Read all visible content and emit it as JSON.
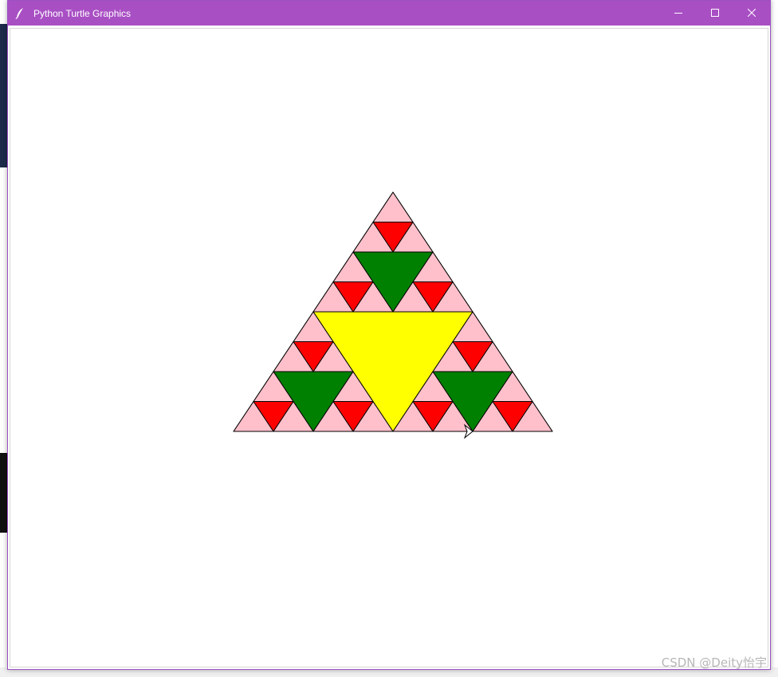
{
  "window": {
    "title": "Python Turtle Graphics",
    "accent": "#a94fc4",
    "controls": {
      "minimize": "minimize-icon",
      "maximize": "maximize-icon",
      "close": "close-icon"
    }
  },
  "fractal": {
    "depth": 3,
    "outline": "#000000",
    "level_colors": [
      "pink",
      "red",
      "green",
      "yellow"
    ],
    "color_hex": {
      "pink": "#ffc0cb",
      "red": "#ff0000",
      "green": "#008000",
      "yellow": "#ffff00"
    },
    "cursor": "turtle-arrow-icon"
  },
  "watermark": "CSDN @Deity怡宇"
}
